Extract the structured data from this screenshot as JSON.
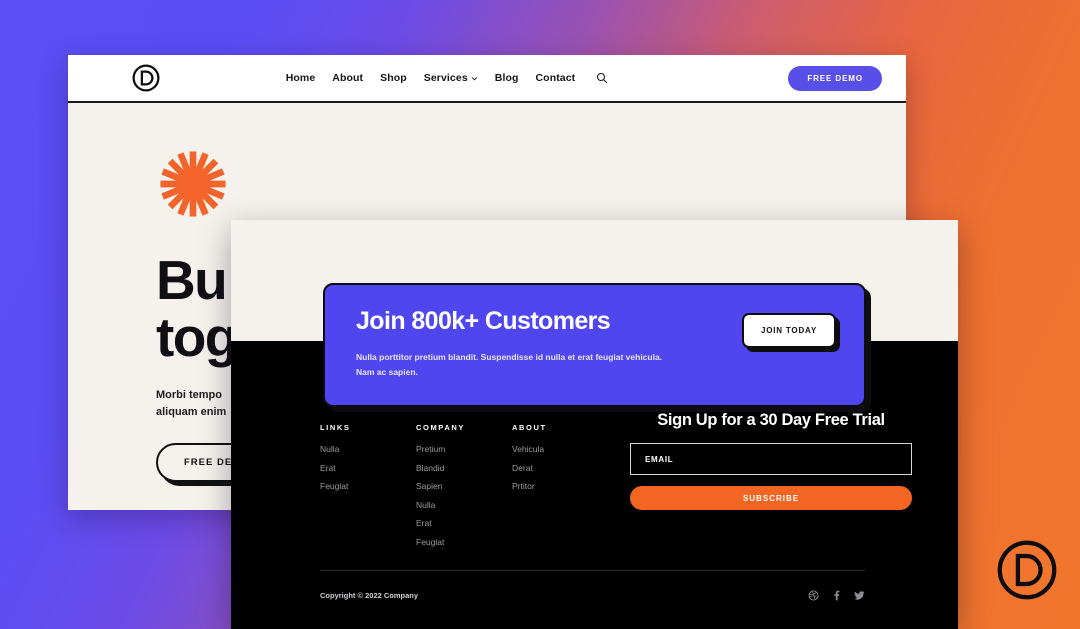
{
  "background": {
    "gradient_from": "#5b4ef5",
    "gradient_to": "#f0762c"
  },
  "watermark": {
    "icon": "divi-d-logo-icon"
  },
  "site": {
    "header": {
      "logo_icon": "divi-d-logo-icon",
      "nav": [
        {
          "label": "Home",
          "icon": ""
        },
        {
          "label": "About",
          "icon": ""
        },
        {
          "label": "Shop",
          "icon": ""
        },
        {
          "label": "Services",
          "icon": "chevron-down-icon"
        },
        {
          "label": "Blog",
          "icon": ""
        },
        {
          "label": "Contact",
          "icon": ""
        }
      ],
      "search_icon": "search-icon",
      "cta_label": "FREE DEMO",
      "cta_color": "#584fe8"
    },
    "hero": {
      "decor_icon": "orange-starburst-icon",
      "decor_color": "#f2642a",
      "title": "Bu\ntog",
      "body": "Morbi tempo\naliquam enim",
      "button_label": "FREE DE",
      "shapes": [
        "blue-sphere",
        "outlined-card",
        "outlined-chip",
        "outlined-chip",
        "outlined-chip"
      ]
    }
  },
  "overlay": {
    "cta": {
      "title": "Join 800k+ Customers",
      "body": "Nulla porttitor pretium blandit. Suspendisse id nulla et erat feugiat vehicula.\nNam ac sapien.",
      "button_label": "JOIN TODAY",
      "background": "#4f46f0"
    },
    "footer": {
      "columns": [
        {
          "heading": "LINKS",
          "links": [
            "Nulla",
            "Erat",
            "Feugiat"
          ]
        },
        {
          "heading": "COMPANY",
          "links": [
            "Pretium",
            "Blandid",
            "Sapien",
            "Nulla",
            "Erat",
            "Feugiat"
          ]
        },
        {
          "heading": "ABOUT",
          "links": [
            "Vehicula",
            "Derat",
            "Prtitor"
          ]
        }
      ],
      "newsletter": {
        "title": "Sign Up for a 30 Day Free Trial",
        "email_placeholder": "EMAIL",
        "email_value": "",
        "subscribe_label": "SUBSCRIBE",
        "subscribe_color": "#f26522"
      },
      "copyright": "Copyright © 2022 Company",
      "socials": [
        "dribbble-icon",
        "facebook-icon",
        "twitter-icon"
      ]
    }
  }
}
